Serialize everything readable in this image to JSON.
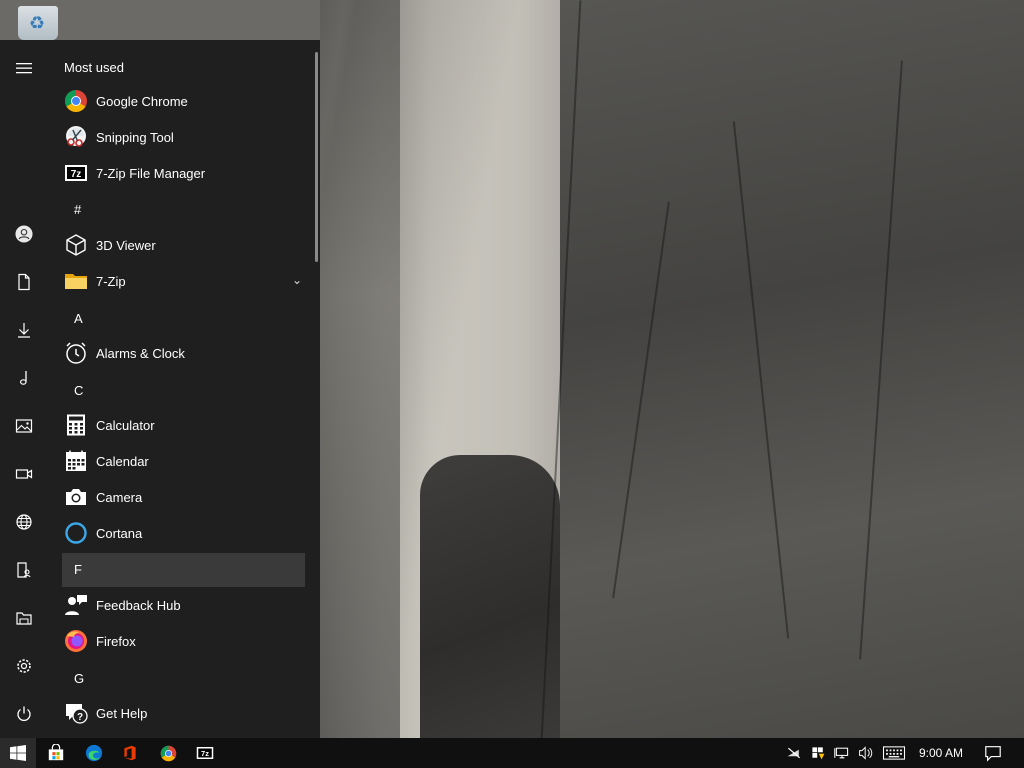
{
  "start_menu": {
    "most_used_title": "Most used",
    "most_used": [
      {
        "label": "Google Chrome",
        "icon": "chrome-icon"
      },
      {
        "label": "Snipping Tool",
        "icon": "scissors-icon"
      },
      {
        "label": "7-Zip File Manager",
        "icon": "7zip-icon"
      }
    ],
    "groups": [
      {
        "letter": "#",
        "apps": [
          {
            "label": "3D Viewer",
            "icon": "3d-cube-icon"
          },
          {
            "label": "7-Zip",
            "icon": "folder-icon",
            "expandable": true
          }
        ]
      },
      {
        "letter": "A",
        "apps": [
          {
            "label": "Alarms & Clock",
            "icon": "alarm-clock-icon"
          }
        ]
      },
      {
        "letter": "C",
        "apps": [
          {
            "label": "Calculator",
            "icon": "calculator-icon"
          },
          {
            "label": "Calendar",
            "icon": "calendar-icon"
          },
          {
            "label": "Camera",
            "icon": "camera-icon"
          },
          {
            "label": "Cortana",
            "icon": "cortana-icon"
          }
        ]
      },
      {
        "letter": "F",
        "highlighted": true,
        "apps": [
          {
            "label": "Feedback Hub",
            "icon": "feedback-hub-icon"
          },
          {
            "label": "Firefox",
            "icon": "firefox-icon"
          }
        ]
      },
      {
        "letter": "G",
        "apps": [
          {
            "label": "Get Help",
            "icon": "get-help-icon"
          }
        ]
      }
    ],
    "rail": [
      "hamburger-menu-icon",
      "user-account-icon",
      "documents-icon",
      "downloads-icon",
      "music-icon",
      "pictures-icon",
      "videos-icon",
      "network-icon",
      "personal-folder-icon",
      "file-explorer-icon",
      "settings-gear-icon",
      "power-icon"
    ]
  },
  "taskbar": {
    "pinned": [
      "microsoft-store-icon",
      "edge-icon",
      "office-icon",
      "chrome-icon",
      "7zip-icon"
    ],
    "tray": [
      "network-disconnected-icon",
      "windows-security-icon",
      "network-display-icon",
      "volume-icon",
      "keyboard-icon"
    ],
    "clock": "9:00 AM"
  }
}
